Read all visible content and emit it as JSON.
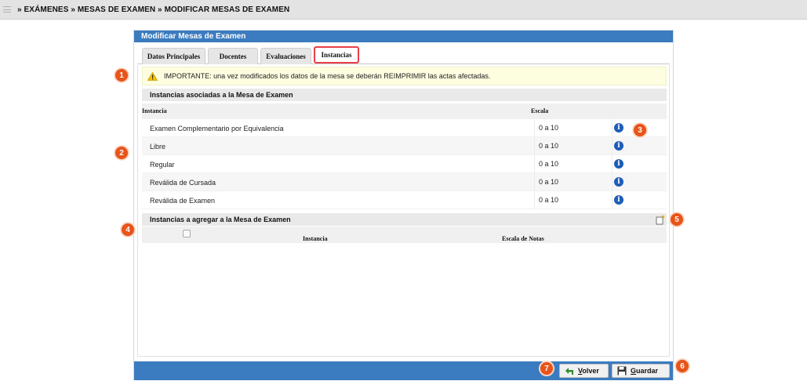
{
  "breadcrumb": "» EXÁMENES » MESAS DE EXAMEN » MODIFICAR MESAS DE EXAMEN",
  "panel_title": "Modificar Mesas de Examen",
  "tabs": [
    {
      "label": "Datos Principales"
    },
    {
      "label": "Docentes"
    },
    {
      "label": "Evaluaciones"
    },
    {
      "label": "Instancias",
      "active": true
    }
  ],
  "warning_text": "IMPORTANTE: una vez modificados los datos de la mesa se deberán REIMPRIMIR las actas afectadas.",
  "section_instancias_asociadas": "Instancias asociadas a la Mesa de Examen",
  "table_instancias": {
    "headers": [
      "Instancia",
      "Escala"
    ],
    "rows": [
      {
        "instancia": "Examen Complementario por Equivalencia",
        "escala": "0 a 10"
      },
      {
        "instancia": "Libre",
        "escala": "0 a 10"
      },
      {
        "instancia": "Regular",
        "escala": "0 a 10"
      },
      {
        "instancia": "Reválida de Cursada",
        "escala": "0 a 10"
      },
      {
        "instancia": "Reválida de Examen",
        "escala": "0 a 10"
      }
    ]
  },
  "section_instancias_agregar": "Instancias a agregar a la Mesa de Examen",
  "table_agregar": {
    "headers": [
      "Instancia",
      "Escala de Notas"
    ]
  },
  "buttons": {
    "volver_prefix": "",
    "volver_access": "V",
    "volver_rest": "olver",
    "guardar_access": "G",
    "guardar_rest": "uardar"
  },
  "badges": [
    "1",
    "2",
    "3",
    "4",
    "5",
    "6",
    "7"
  ],
  "colors": {
    "header_blue": "#3b7bbf",
    "badge_orange": "#e8541a",
    "active_tab_border": "#e8404a",
    "warning_bg": "#fdfde0",
    "info_icon": "#1e5db8"
  },
  "icons": {
    "menu": "menu-icon",
    "warning": "warning-icon",
    "info": "info-icon",
    "add": "add-row-icon",
    "back": "back-arrow-icon",
    "save": "save-disk-icon"
  }
}
